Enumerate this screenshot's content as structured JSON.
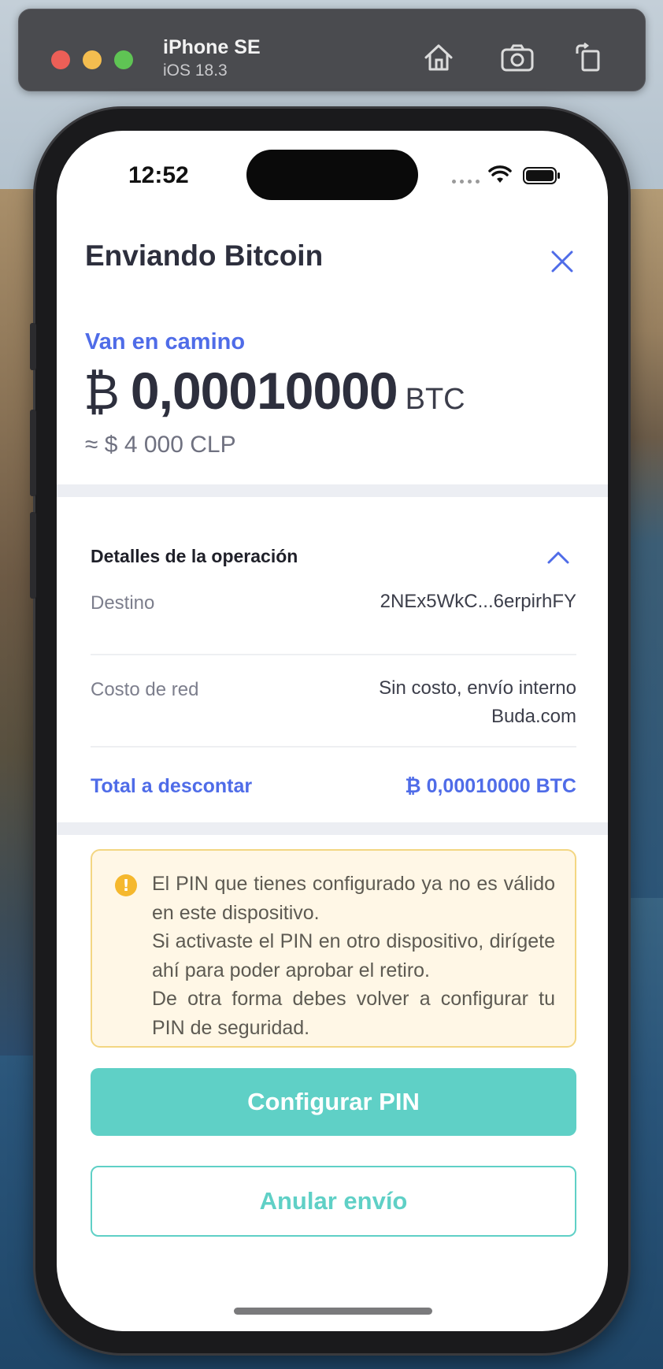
{
  "simulator": {
    "device_name": "iPhone SE",
    "os_version": "iOS 18.3",
    "toolbar_icons": [
      "home-icon",
      "screenshot-icon",
      "rotate-icon"
    ]
  },
  "status_bar": {
    "time": "12:52"
  },
  "header": {
    "title": "Enviando Bitcoin",
    "close_icon": "close-icon"
  },
  "summary": {
    "status_label": "Van en camino",
    "currency_symbol": "₿",
    "amount": "0,00010000",
    "unit": "BTC",
    "fiat_equivalent": "≈ $ 4 000 CLP"
  },
  "details": {
    "title": "Detalles de la operación",
    "rows": [
      {
        "label": "Destino",
        "value": "2NEx5WkC...6erpirhFY"
      },
      {
        "label": "Costo de red",
        "value_line1": "Sin costo, envío interno",
        "value_line2": "Buda.com"
      }
    ],
    "total_label": "Total a descontar",
    "total_value": "₿ 0,00010000 BTC"
  },
  "warning": {
    "icon": "exclamation-icon",
    "line1": "El PIN que tienes configurado ya no es válido en este dispositivo.",
    "line2": "Si activaste el PIN en otro dispositivo, dirígete ahí para poder aprobar el retiro.",
    "line3": "De otra forma debes volver a configurar tu PIN de seguridad."
  },
  "actions": {
    "primary_label": "Configurar PIN",
    "secondary_label": "Anular envío"
  },
  "colors": {
    "accent_blue": "#4f6ce8",
    "teal": "#5fd0c6",
    "warning_bg": "#fff7e6",
    "warning_border": "#f3d682"
  }
}
